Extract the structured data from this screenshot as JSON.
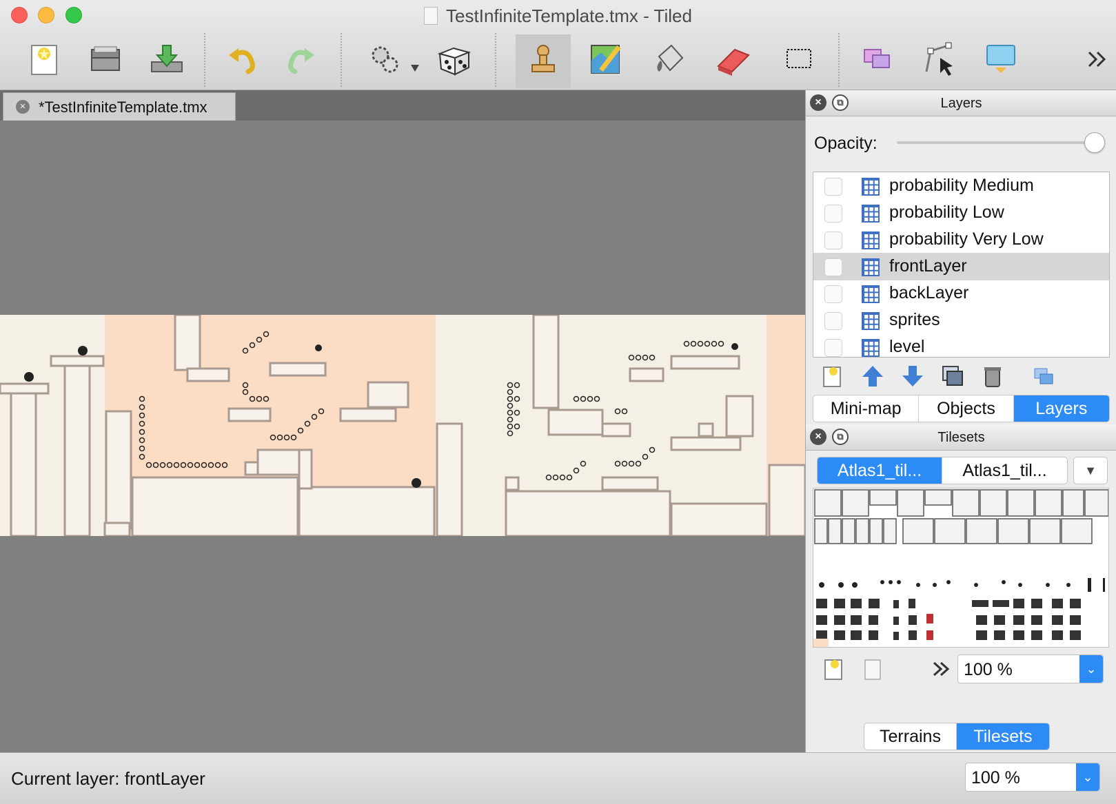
{
  "window": {
    "title": "TestInfiniteTemplate.tmx - Tiled"
  },
  "toolbar": {
    "buttons": [
      {
        "name": "new-map-button",
        "icon": "new-file-icon"
      },
      {
        "name": "open-button",
        "icon": "folder-open-icon"
      },
      {
        "name": "save-button",
        "icon": "save-download-icon"
      },
      {
        "name": "undo-button",
        "icon": "undo-arrow-icon"
      },
      {
        "name": "redo-button",
        "icon": "redo-arrow-icon"
      },
      {
        "name": "commands-button",
        "icon": "gears-icon"
      },
      {
        "name": "random-mode-button",
        "icon": "dice-icon"
      },
      {
        "name": "stamp-brush-button",
        "icon": "stamp-icon"
      },
      {
        "name": "terrain-brush-button",
        "icon": "terrain-brush-icon"
      },
      {
        "name": "bucket-fill-button",
        "icon": "bucket-fill-icon"
      },
      {
        "name": "eraser-button",
        "icon": "eraser-icon"
      },
      {
        "name": "rectangle-select-button",
        "icon": "rectangle-select-icon"
      },
      {
        "name": "select-objects-button",
        "icon": "select-objects-icon"
      },
      {
        "name": "edit-polygons-button",
        "icon": "edit-polygons-icon"
      },
      {
        "name": "insert-tile-button",
        "icon": "insert-tile-icon"
      },
      {
        "name": "more-tools-button",
        "icon": "double-chevron-icon"
      }
    ],
    "active_tool": "stamp-brush-button"
  },
  "document_tab": {
    "label": "*TestInfiniteTemplate.tmx"
  },
  "layers_panel": {
    "title": "Layers",
    "opacity_label": "Opacity:",
    "opacity": 1.0,
    "items": [
      {
        "label": "probability Medium",
        "visible": false,
        "selected": false
      },
      {
        "label": "probability Low",
        "visible": false,
        "selected": false
      },
      {
        "label": "probability Very Low",
        "visible": false,
        "selected": false
      },
      {
        "label": "frontLayer",
        "visible": false,
        "selected": true
      },
      {
        "label": "backLayer",
        "visible": false,
        "selected": false
      },
      {
        "label": "sprites",
        "visible": false,
        "selected": false
      },
      {
        "label": "level",
        "visible": false,
        "selected": false
      }
    ],
    "tabs": [
      {
        "label": "Mini-map",
        "active": false
      },
      {
        "label": "Objects",
        "active": false
      },
      {
        "label": "Layers",
        "active": true
      }
    ]
  },
  "tilesets_panel": {
    "title": "Tilesets",
    "tabs": [
      {
        "label": "Atlas1_til...",
        "active": true
      },
      {
        "label": "Atlas1_til...",
        "active": false
      }
    ],
    "zoom": "100 %",
    "bottom_tabs": [
      {
        "label": "Terrains",
        "active": false
      },
      {
        "label": "Tilesets",
        "active": true
      }
    ]
  },
  "status_bar": {
    "current_layer": "Current layer: frontLayer",
    "zoom": "100 %"
  },
  "colors": {
    "accent": "#2d8bf6",
    "canvas_bg": "#808080",
    "map_bg": "#f4f0e6",
    "map_tint": "#fbdcc4",
    "tile_stroke": "#a89a90"
  }
}
